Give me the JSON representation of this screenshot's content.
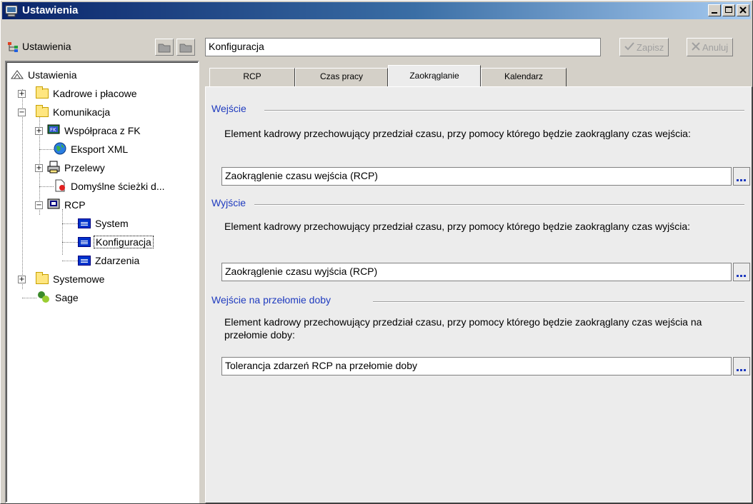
{
  "window": {
    "title": "Ustawienia",
    "icon": "settings-app-icon"
  },
  "left": {
    "header_label": "Ustawienia",
    "tree": [
      {
        "label": "Ustawienia",
        "icon": "ustawienia-icon",
        "level": 0
      },
      {
        "label": "Kadrowe i płacowe",
        "icon": "folder-icon",
        "level": 1,
        "expander": "+"
      },
      {
        "label": "Komunikacja",
        "icon": "folder-icon",
        "level": 1,
        "expander": "−"
      },
      {
        "label": "Współpraca z FK",
        "icon": "fk-icon",
        "level": 2,
        "expander": "+"
      },
      {
        "label": "Eksport XML",
        "icon": "globe-icon",
        "level": 2
      },
      {
        "label": "Przelewy",
        "icon": "printer-icon",
        "level": 2,
        "expander": "+"
      },
      {
        "label": "Domyślne ścieżki d...",
        "icon": "document-icon",
        "level": 2
      },
      {
        "label": "RCP",
        "icon": "rcp-icon",
        "level": 2,
        "expander": "−"
      },
      {
        "label": "System",
        "icon": "list-icon",
        "level": 3
      },
      {
        "label": "Konfiguracja",
        "icon": "list-icon",
        "level": 3,
        "selected": true
      },
      {
        "label": "Zdarzenia",
        "icon": "list-icon",
        "level": 3
      },
      {
        "label": "Systemowe",
        "icon": "folder-icon",
        "level": 1,
        "expander": "+"
      },
      {
        "label": "Sage",
        "icon": "sage-icon",
        "level": 1
      }
    ]
  },
  "right": {
    "path": "Konfiguracja",
    "save_label": "Zapisz",
    "cancel_label": "Anuluj",
    "tabs": [
      "RCP",
      "Czas pracy",
      "Zaokrąglanie",
      "Kalendarz"
    ],
    "active_tab": "Zaokrąglanie",
    "sections": [
      {
        "title": "Wejście",
        "description": "Element kadrowy przechowujący przedział czasu, przy pomocy którego będzie zaokrąglany czas wejścia:",
        "value": "Zaokrąglenie czasu wejścia (RCP)"
      },
      {
        "title": "Wyjście",
        "description": "Element kadrowy przechowujący przedział czasu, przy pomocy którego będzie zaokrąglany czas wyjścia:",
        "value": "Zaokrąglenie czasu wyjścia (RCP)"
      },
      {
        "title": "Wejście na przełomie doby",
        "description": "Element kadrowy przechowujący przedział czasu, przy pomocy którego będzie zaokrąglany czas wejścia na przełomie doby:",
        "value": "Tolerancja zdarzeń RCP na przełomie doby"
      }
    ]
  },
  "colors": {
    "section_title": "#1f3bbf",
    "titlebar_start": "#0a246a",
    "face": "#d4d0c8"
  }
}
